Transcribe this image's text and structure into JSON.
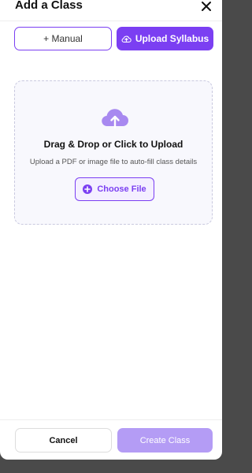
{
  "modal": {
    "title": "Add a Class"
  },
  "tabs": {
    "manual_label": "+ Manual",
    "upload_label": "Upload Syllabus"
  },
  "upload": {
    "title": "Drag & Drop or Click to Upload",
    "subtitle": "Upload a PDF or image file to auto-fill class details",
    "choose_label": "Choose File"
  },
  "footer": {
    "cancel_label": "Cancel",
    "create_label": "Create Class"
  },
  "icons": {
    "close": "close-icon",
    "upload_tab": "cloud-upload-icon",
    "dropzone": "cloud-upload-icon",
    "choose": "plus-circle-icon"
  },
  "colors": {
    "accent": "#7b3ff2",
    "accent_light": "#b49cf5",
    "dropzone_bg": "#f8f8fd",
    "backdrop": "#4a4a4a"
  }
}
